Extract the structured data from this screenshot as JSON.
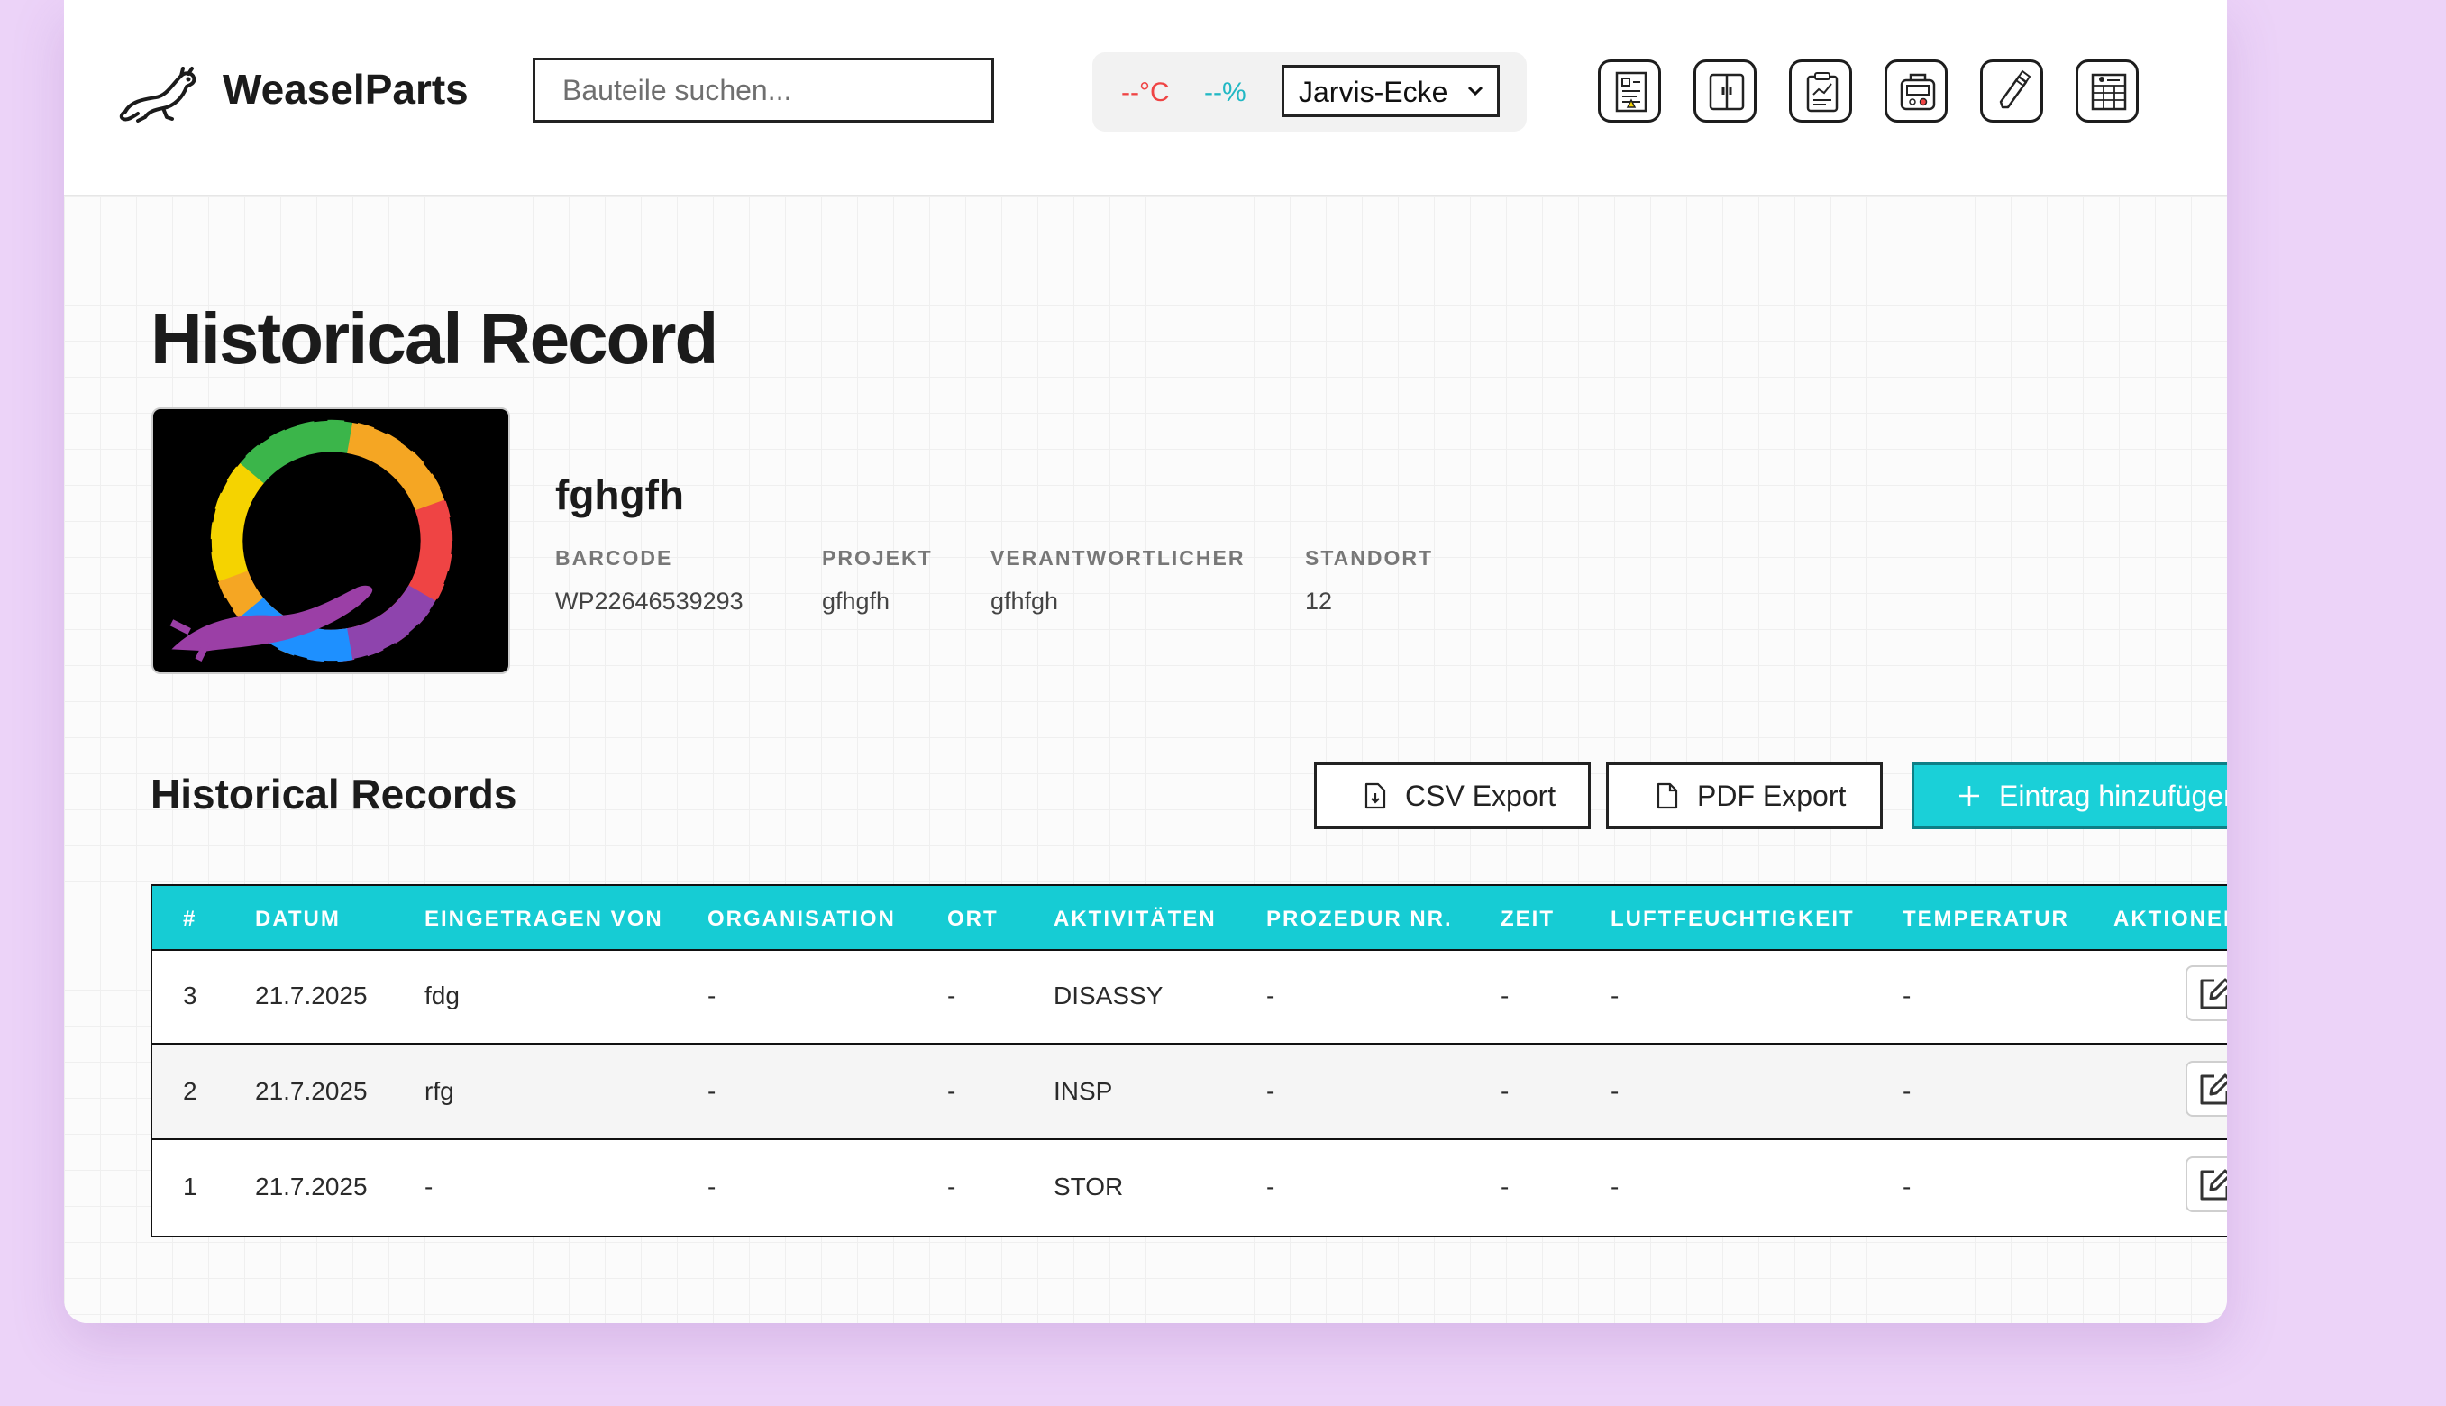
{
  "app": {
    "brand": "WeaselParts"
  },
  "search": {
    "placeholder": "Bauteile suchen..."
  },
  "climate": {
    "temperature": "--°C",
    "humidity": "--%",
    "location": "Jarvis-Ecke"
  },
  "toolbar": {
    "icons": [
      "inventory-sheet-icon",
      "cabinet-icon",
      "clipboard-chart-icon",
      "scale-device-icon",
      "pen-tool-icon",
      "calendar-grid-icon"
    ]
  },
  "page": {
    "title": "Historical Record"
  },
  "part": {
    "name": "fghgfh",
    "labels": {
      "barcode": "BARCODE",
      "project": "PROJEKT",
      "owner": "VERANTWORTLICHER",
      "location": "STANDORT"
    },
    "barcode": "WP22646539293",
    "project": "gfhgfh",
    "owner": "gfhfgh",
    "location": "12"
  },
  "records": {
    "title": "Historical Records",
    "csv_label": "CSV Export",
    "pdf_label": "PDF Export",
    "add_label": "Eintrag hinzufügen",
    "columns": [
      "#",
      "DATUM",
      "EINGETRAGEN VON",
      "ORGANISATION",
      "ORT",
      "AKTIVITÄTEN",
      "PROZEDUR NR.",
      "ZEIT",
      "LUFTFEUCHTIGKEIT",
      "TEMPERATUR",
      "AKTIONEN"
    ],
    "rows": [
      {
        "num": "3",
        "date": "21.7.2025",
        "by": "fdg",
        "org": "-",
        "place": "-",
        "activity": "DISASSY",
        "procedure": "-",
        "time": "-",
        "humidity": "-",
        "temperature": "-"
      },
      {
        "num": "2",
        "date": "21.7.2025",
        "by": "rfg",
        "org": "-",
        "place": "-",
        "activity": "INSP",
        "procedure": "-",
        "time": "-",
        "humidity": "-",
        "temperature": "-"
      },
      {
        "num": "1",
        "date": "21.7.2025",
        "by": "-",
        "org": "-",
        "place": "-",
        "activity": "STOR",
        "procedure": "-",
        "time": "-",
        "humidity": "-",
        "temperature": "-"
      }
    ]
  },
  "colors": {
    "accent": "#16ccd4",
    "background": "#ecd3f8",
    "temperature": "#ef4444",
    "humidity": "#22b8c4"
  }
}
